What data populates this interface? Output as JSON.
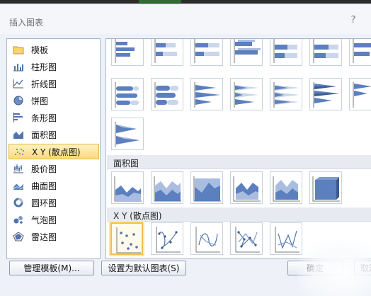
{
  "dialog": {
    "title": "插入图表",
    "help": "?"
  },
  "categories": [
    {
      "label": "模板",
      "icon": "folder-icon"
    },
    {
      "label": "柱形图",
      "icon": "column-chart-icon"
    },
    {
      "label": "折线图",
      "icon": "line-chart-icon"
    },
    {
      "label": "饼图",
      "icon": "pie-chart-icon"
    },
    {
      "label": "条形图",
      "icon": "bar-chart-icon"
    },
    {
      "label": "面积图",
      "icon": "area-chart-icon"
    },
    {
      "label": "X Y (散点图)",
      "icon": "scatter-chart-icon",
      "selected": true
    },
    {
      "label": "股价图",
      "icon": "stock-chart-icon"
    },
    {
      "label": "曲面图",
      "icon": "surface-chart-icon"
    },
    {
      "label": "圆环图",
      "icon": "doughnut-chart-icon"
    },
    {
      "label": "气泡图",
      "icon": "bubble-chart-icon"
    },
    {
      "label": "雷达图",
      "icon": "radar-chart-icon"
    }
  ],
  "gallery": {
    "area_header": "面积图",
    "scatter_header": "X Y (散点图)"
  },
  "buttons": {
    "manage_templates": "管理模板(M)...",
    "set_default": "设置为默认图表(S)",
    "ok": "确定",
    "cancel": "取消"
  },
  "colors": {
    "accent": "#4f74b0",
    "selection": "#f2c04c"
  }
}
